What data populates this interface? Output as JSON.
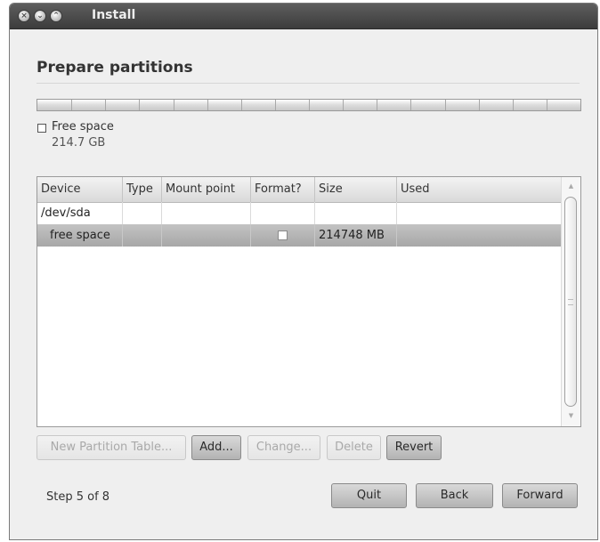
{
  "window": {
    "title": "Install",
    "controls": [
      "close-icon",
      "minimize-icon",
      "maximize-icon"
    ]
  },
  "page": {
    "title": "Prepare partitions"
  },
  "partition_bar": {
    "segments": 16,
    "legend": {
      "label": "Free space",
      "size": "214.7 GB"
    }
  },
  "table": {
    "columns": [
      "Device",
      "Type",
      "Mount point",
      "Format?",
      "Size",
      "Used"
    ],
    "rows": [
      {
        "device": "/dev/sda",
        "type": "",
        "mount": "",
        "format": "",
        "size": "",
        "used": "",
        "selected": false
      },
      {
        "device": "free space",
        "type": "",
        "mount": "",
        "format": "unchecked",
        "size": "214748 MB",
        "used": "",
        "selected": true
      }
    ]
  },
  "actions": {
    "new_partition_table": "New Partition Table...",
    "add": "Add...",
    "change": "Change...",
    "delete": "Delete",
    "revert": "Revert"
  },
  "footer": {
    "step": "Step 5 of 8",
    "quit": "Quit",
    "back": "Back",
    "forward": "Forward"
  }
}
